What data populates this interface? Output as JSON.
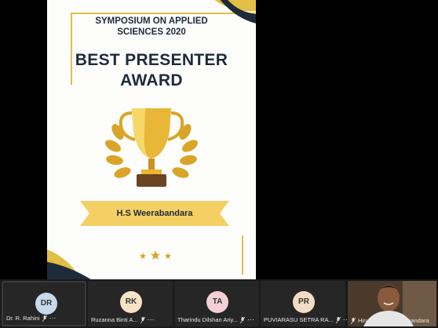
{
  "poster": {
    "symposium_line1": "SYMPOSIUM ON APPLIED",
    "symposium_line2": "SCIENCES 2020",
    "award_line1": "BEST PRESENTER",
    "award_line2": "AWARD",
    "recipient": "H.S Weerabandara"
  },
  "colors": {
    "navy": "#1e2b3a",
    "gold": "#e3bf45",
    "ribbon": "#f4cf63"
  },
  "participants": [
    {
      "initials": "DR",
      "name": "Dr. R. Rahini",
      "avatar_color": "#c9d9ec",
      "active": true
    },
    {
      "initials": "RK",
      "name": "Ruzanna Binti A...",
      "avatar_color": "#f6e3c5"
    },
    {
      "initials": "TA",
      "name": "Tharindu Dilshan Ariy...",
      "avatar_color": "#f2d0d4"
    },
    {
      "initials": "PR",
      "name": "PUVIARASU SETRA RA...",
      "avatar_color": "#f4dcc4"
    },
    {
      "initials": "",
      "name": "Hiru Sahaja Weerabandara",
      "video": true
    }
  ],
  "icons": {
    "mic": "mic-muted-icon",
    "more": "more-options-icon"
  },
  "more_glyph": "⋯"
}
